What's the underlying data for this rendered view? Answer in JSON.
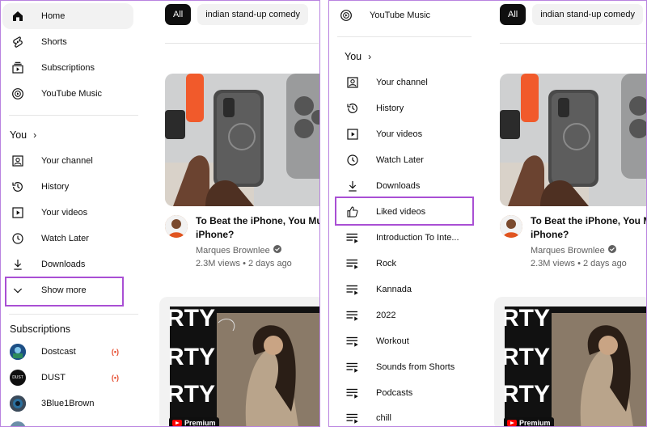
{
  "left": {
    "nav": [
      {
        "label": "Home",
        "icon": "home-icon"
      },
      {
        "label": "Shorts",
        "icon": "shorts-icon"
      },
      {
        "label": "Subscriptions",
        "icon": "subscriptions-icon"
      },
      {
        "label": "YouTube Music",
        "icon": "youtube-music-icon"
      }
    ],
    "you_title": "You",
    "you_items": [
      {
        "label": "Your channel",
        "icon": "your-channel-icon"
      },
      {
        "label": "History",
        "icon": "history-icon"
      },
      {
        "label": "Your videos",
        "icon": "your-videos-icon"
      },
      {
        "label": "Watch Later",
        "icon": "watch-later-icon"
      },
      {
        "label": "Downloads",
        "icon": "downloads-icon"
      },
      {
        "label": "Show more",
        "icon": "chevron-down-icon"
      }
    ],
    "subscriptions_title": "Subscriptions",
    "subscriptions": [
      {
        "label": "Dostcast",
        "live": true
      },
      {
        "label": "DUST",
        "live": true,
        "avatar_text": "DUST"
      },
      {
        "label": "3Blue1Brown",
        "live": false
      }
    ]
  },
  "right": {
    "nav_top": {
      "label": "YouTube Music",
      "icon": "youtube-music-icon"
    },
    "you_title": "You",
    "you_items": [
      {
        "label": "Your channel",
        "icon": "your-channel-icon"
      },
      {
        "label": "History",
        "icon": "history-icon"
      },
      {
        "label": "Your videos",
        "icon": "your-videos-icon"
      },
      {
        "label": "Watch Later",
        "icon": "watch-later-icon"
      },
      {
        "label": "Downloads",
        "icon": "downloads-icon"
      },
      {
        "label": "Liked videos",
        "icon": "liked-videos-icon"
      }
    ],
    "playlists": [
      {
        "label": "Introduction To Inte..."
      },
      {
        "label": "Rock"
      },
      {
        "label": "Kannada"
      },
      {
        "label": "2022"
      },
      {
        "label": "Workout"
      },
      {
        "label": "Sounds from Shorts"
      },
      {
        "label": "Podcasts"
      },
      {
        "label": "chill"
      }
    ]
  },
  "feed": {
    "chips": [
      "All",
      "indian stand-up comedy"
    ],
    "video": {
      "title": "To Beat the iPhone, You Must Beat the iPhone?",
      "title_line1_left": "To Beat the iPhone, You Mu",
      "title_line1_right": "To Beat the iPhone, You M",
      "title_line2": "iPhone?",
      "channel": "Marques Brownlee",
      "meta": "2.3M views • 2 days ago"
    },
    "second_video": {
      "badge": "Premium",
      "overlay_text": "RTY"
    }
  },
  "colors": {
    "highlight": "#a94fd4",
    "chip_selected": "#0f0f0f",
    "live": "#e54a2c"
  }
}
